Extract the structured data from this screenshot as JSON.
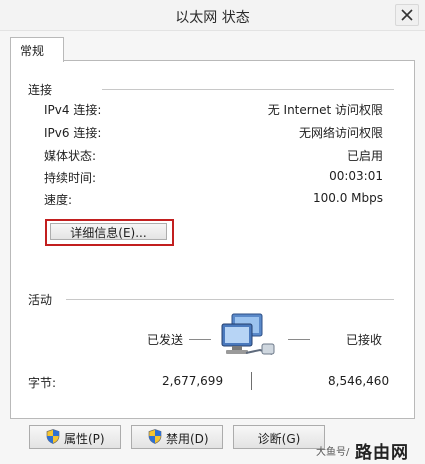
{
  "window": {
    "title": "以太网 状态"
  },
  "tabs": [
    {
      "label": "常规"
    }
  ],
  "connection": {
    "group_label": "连接",
    "rows": [
      {
        "label": "IPv4 连接:",
        "value": "无 Internet 访问权限"
      },
      {
        "label": "IPv6 连接:",
        "value": "无网络访问权限"
      },
      {
        "label": "媒体状态:",
        "value": "已启用"
      },
      {
        "label": "持续时间:",
        "value": "00:03:01"
      },
      {
        "label": "速度:",
        "value": "100.0 Mbps"
      }
    ],
    "details_button": "详细信息(E)..."
  },
  "activity": {
    "group_label": "活动",
    "sent_label": "已发送",
    "received_label": "已接收",
    "bytes_label": "字节:",
    "bytes_sent": "2,677,699",
    "bytes_received": "8,546,460"
  },
  "buttons": {
    "properties": "属性(P)",
    "disable": "禁用(D)",
    "diagnose": "诊断(G)"
  },
  "watermark": {
    "small": "大鱼号/",
    "big": "路由网"
  },
  "colors": {
    "highlight_border": "#c21f1f",
    "window_bg": "#f6f6f6"
  },
  "icons": {
    "close": "close-icon",
    "network": "network-computers-icon",
    "shield": "shield-icon"
  }
}
